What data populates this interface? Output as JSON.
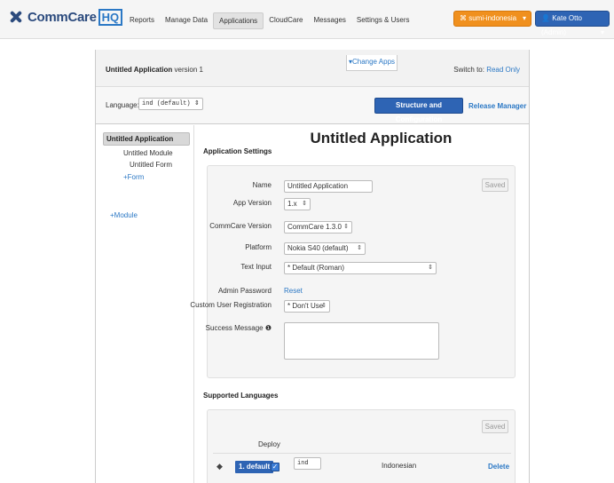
{
  "nav": {
    "logo_text": "CommCare",
    "logo_badge": "HQ",
    "items": [
      {
        "label": "Reports"
      },
      {
        "label": "Manage Data"
      },
      {
        "label": "Applications",
        "active": true
      },
      {
        "label": "CloudCare"
      },
      {
        "label": "Messages"
      },
      {
        "label": "Settings & Users"
      }
    ],
    "project_label": "sumi-indonesia",
    "user_label": "Kate Otto (Admin)",
    "project_color": "#f0901e",
    "user_color": "#2e64b4"
  },
  "app_header": {
    "title_bold": "Untitled Application",
    "title_suffix": " version 1",
    "change_apps": "Change Apps",
    "switch_prefix": "Switch to: ",
    "switch_link": "Read Only"
  },
  "language_bar": {
    "label": "Language:",
    "selected": "ind (default)",
    "structure_button": "Structure and Configuration",
    "release_link": "Release Manager"
  },
  "sidebar": {
    "app": "Untitled Application",
    "module": "Untitled Module",
    "form": "Untitled Form",
    "add_form": "Form",
    "add_module": "Module"
  },
  "main": {
    "title": "Untitled Application",
    "settings_title": "Application Settings",
    "saved_label": "Saved",
    "fields": {
      "name_label": "Name",
      "name_value": "Untitled Application",
      "app_version_label": "App Version",
      "app_version_value": "1.x",
      "commcare_version_label": "CommCare Version",
      "commcare_version_value": "CommCare 1.3.0",
      "platform_label": "Platform",
      "platform_value": "Nokia S40 (default)",
      "text_input_label": "Text Input",
      "text_input_value": "* Default (Roman)",
      "admin_password_label": "Admin Password",
      "admin_password_link": "Reset",
      "custom_reg_label": "Custom User Registration",
      "custom_reg_value": "* Don't Use",
      "success_message_label": "Success Message"
    },
    "languages": {
      "title": "Supported Languages",
      "saved_label": "Saved",
      "deploy_header": "Deploy",
      "rows": [
        {
          "badge": "1. default",
          "code": "ind",
          "name": "Indonesian",
          "delete": "Delete"
        }
      ]
    }
  },
  "icons": {
    "arrows": "⇕",
    "plus": "+",
    "caret_down": "▾",
    "info": "❶",
    "check": "✓",
    "drag": "◆"
  }
}
